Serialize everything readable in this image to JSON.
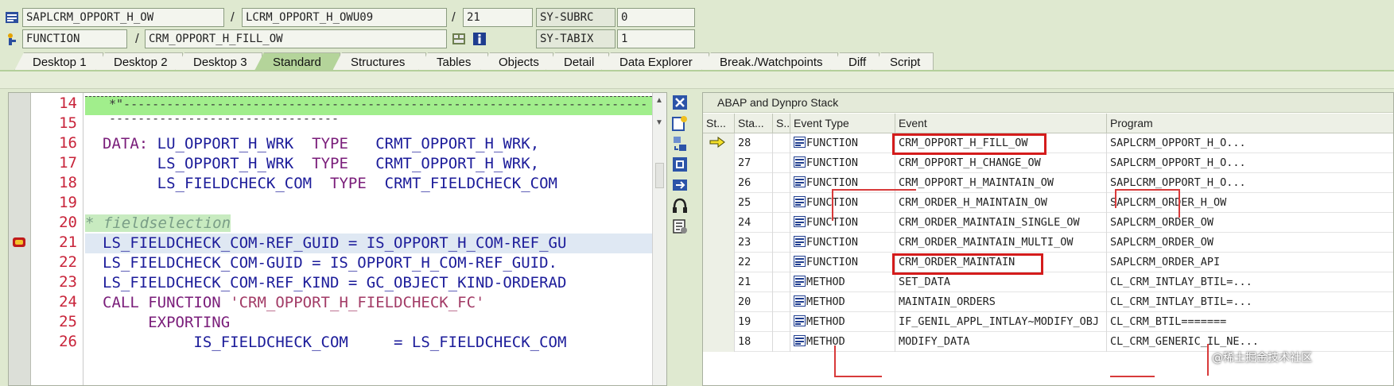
{
  "info": {
    "program": "SAPLCRM_OPPORT_H_OW",
    "include": "LCRM_OPPORT_H_OWU09",
    "line": "21",
    "sy_subrc_label": "SY-SUBRC",
    "sy_subrc_value": "0",
    "event_type": "FUNCTION",
    "event": "CRM_OPPORT_H_FILL_OW",
    "sy_tabix_label": "SY-TABIX",
    "sy_tabix_value": "1",
    "separator": "/"
  },
  "tabs": [
    {
      "label": "Desktop 1",
      "active": false
    },
    {
      "label": "Desktop 2",
      "active": false
    },
    {
      "label": "Desktop 3",
      "active": false
    },
    {
      "label": "Standard",
      "active": true
    },
    {
      "label": "Structures",
      "active": false
    },
    {
      "label": "Tables",
      "active": false
    },
    {
      "label": "Objects",
      "active": false
    },
    {
      "label": "Detail",
      "active": false
    },
    {
      "label": "Data Explorer",
      "active": false
    },
    {
      "label": "Break./Watchpoints",
      "active": false
    },
    {
      "label": "Diff",
      "active": false
    },
    {
      "label": "Script",
      "active": false
    }
  ],
  "editor": {
    "line_numbers": [
      "14",
      "15",
      "16",
      "17",
      "18",
      "19",
      "20",
      "21",
      "22",
      "23",
      "24",
      "25",
      "26"
    ],
    "range_marker": "*\"---------------------------------------------------------------------------------------------------------",
    "lines": {
      "l16_kw1": "DATA:",
      "l16_id": "LU_OPPORT_H_WRK",
      "l16_kw2": "TYPE",
      "l16_type": "CRMT_OPPORT_H_WRK,",
      "l17_id": "LS_OPPORT_H_WRK",
      "l17_kw": "TYPE",
      "l17_type": "CRMT_OPPORT_H_WRK,",
      "l18_id": "LS_FIELDCHECK_COM",
      "l18_kw": "TYPE",
      "l18_type": "CRMT_FIELDCHECK_COM",
      "l20_comment": "* fieldselection",
      "l21": "LS_FIELDCHECK_COM-REF_GUID = IS_OPPORT_H_COM-REF_GU",
      "l22": "LS_FIELDCHECK_COM-GUID = IS_OPPORT_H_COM-REF_GUID.",
      "l23": "LS_FIELDCHECK_COM-REF_KIND = GC_OBJECT_KIND-ORDERAD",
      "l24_kw": "CALL FUNCTION",
      "l24_str": "'CRM_OPPORT_H_FIELDCHECK_FC'",
      "l25_kw": "EXPORTING",
      "l26": "IS_FIELDCHECK_COM     = LS_FIELDCHECK_COM"
    }
  },
  "stack": {
    "title": "ABAP and Dynpro Stack",
    "columns": [
      "St...",
      "Sta...",
      "S...",
      "Event Type",
      "Event",
      "Program"
    ],
    "rows": [
      {
        "level": "28",
        "type": "FUNCTION",
        "event": "CRM_OPPORT_H_FILL_OW",
        "program": "SAPLCRM_OPPORT_H_O...",
        "current": true
      },
      {
        "level": "27",
        "type": "FUNCTION",
        "event": "CRM_OPPORT_H_CHANGE_OW",
        "program": "SAPLCRM_OPPORT_H_O...",
        "current": false
      },
      {
        "level": "26",
        "type": "FUNCTION",
        "event": "CRM_OPPORT_H_MAINTAIN_OW",
        "program": "SAPLCRM_OPPORT_H_O...",
        "current": false
      },
      {
        "level": "25",
        "type": "FUNCTION",
        "event": "CRM_ORDER_H_MAINTAIN_OW",
        "program": "SAPLCRM_ORDER_H_OW",
        "current": false
      },
      {
        "level": "24",
        "type": "FUNCTION",
        "event": "CRM_ORDER_MAINTAIN_SINGLE_OW",
        "program": "SAPLCRM_ORDER_OW",
        "current": false
      },
      {
        "level": "23",
        "type": "FUNCTION",
        "event": "CRM_ORDER_MAINTAIN_MULTI_OW",
        "program": "SAPLCRM_ORDER_OW",
        "current": false
      },
      {
        "level": "22",
        "type": "FUNCTION",
        "event": "CRM_ORDER_MAINTAIN",
        "program": "SAPLCRM_ORDER_API",
        "current": false
      },
      {
        "level": "21",
        "type": "METHOD",
        "event": "SET_DATA",
        "program": "CL_CRM_INTLAY_BTIL=...",
        "current": false
      },
      {
        "level": "20",
        "type": "METHOD",
        "event": "MAINTAIN_ORDERS",
        "program": "CL_CRM_INTLAY_BTIL=...",
        "current": false
      },
      {
        "level": "19",
        "type": "METHOD",
        "event": "IF_GENIL_APPL_INTLAY~MODIFY_OBJ",
        "program": "CL_CRM_BTIL=======",
        "current": false
      },
      {
        "level": "18",
        "type": "METHOD",
        "event": "MODIFY_DATA",
        "program": "CL_CRM_GENERIC_IL_NE...",
        "current": false
      }
    ]
  },
  "watermark": "@稀土掘金技术社区",
  "colors": {
    "accent_green": "#a1ee8c",
    "highlight_red": "#d41c1c",
    "line_number_red": "#c8243a"
  }
}
